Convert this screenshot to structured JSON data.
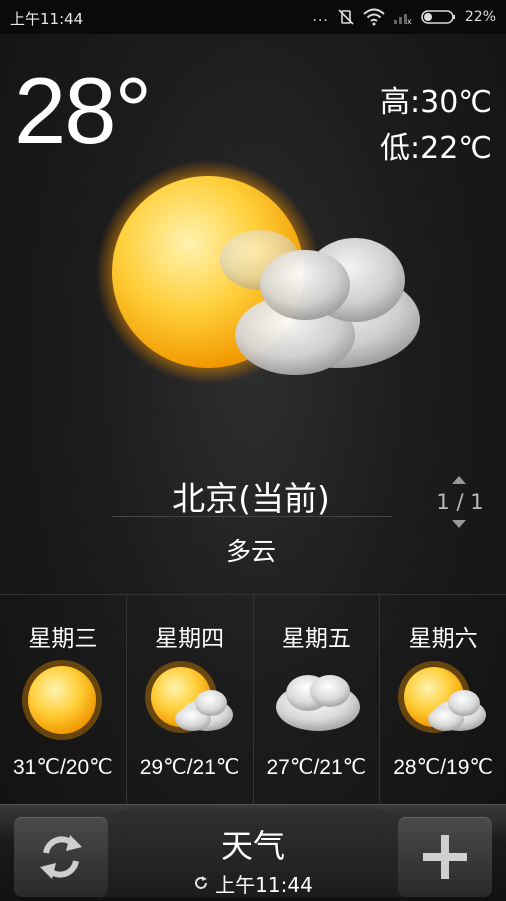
{
  "status": {
    "time": "上午11:44",
    "dots": "...",
    "battery": "22%"
  },
  "current": {
    "temp": "28°",
    "high": "高:30℃",
    "low": "低:22℃",
    "city": "北京(当前)",
    "condition": "多云",
    "icon": "partly-cloudy-icon",
    "page": "1 / 1"
  },
  "forecast": [
    {
      "day": "星期三",
      "icon": "sunny-icon",
      "temps": "31℃/20℃"
    },
    {
      "day": "星期四",
      "icon": "partly-cloudy-icon",
      "temps": "29℃/21℃"
    },
    {
      "day": "星期五",
      "icon": "cloudy-icon",
      "temps": "27℃/21℃"
    },
    {
      "day": "星期六",
      "icon": "partly-cloudy-icon",
      "temps": "28℃/19℃"
    }
  ],
  "bottom": {
    "title": "天气",
    "updated": "上午11:44"
  },
  "colors": {
    "sun_core": "#ffb400",
    "sun_light": "#ffe680",
    "cloud": "#e6e6e6",
    "background": "#1c1c1c"
  }
}
